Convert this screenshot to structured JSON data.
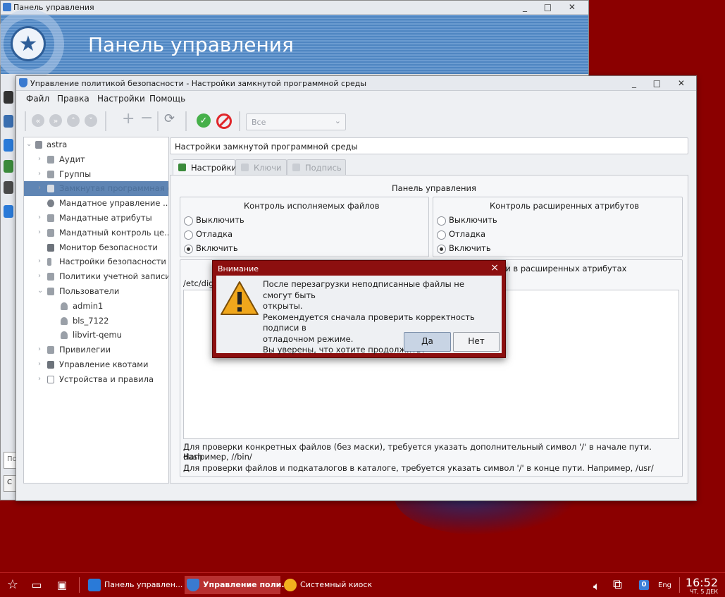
{
  "colors": {
    "desktop": "#8b0000",
    "accent": "#5f85b4",
    "dialog_frame": "#8c0f0f",
    "ok_green": "#46b04a",
    "cancel_red": "#e0262a"
  },
  "back_window": {
    "title": "Панель управления",
    "banner_title": "Панель управления",
    "search_placeholder": "По",
    "button_label": "С"
  },
  "main_window": {
    "title": "Управление политикой безопасности - Настройки замкнутой программной среды",
    "menu": [
      "Файл",
      "Правка",
      "Настройки",
      "Помощь"
    ],
    "toolbar": {
      "icons": [
        "back-double-icon",
        "forward-double-icon",
        "up-icon",
        "down-icon",
        "add-icon",
        "remove-icon",
        "refresh-icon",
        "apply-icon",
        "cancel-icon"
      ],
      "filter_value": "Все"
    }
  },
  "tree": {
    "root": "astra",
    "items": [
      {
        "label": "Аудит",
        "level": 1,
        "expandable": true
      },
      {
        "label": "Группы",
        "level": 1,
        "expandable": true
      },
      {
        "label": "Замкнутая программная среда",
        "level": 1,
        "expandable": true,
        "selected": true
      },
      {
        "label": "Мандатное управление ...",
        "level": 1,
        "expandable": false
      },
      {
        "label": "Мандатные атрибуты",
        "level": 1,
        "expandable": true
      },
      {
        "label": "Мандатный контроль це...",
        "level": 1,
        "expandable": true
      },
      {
        "label": "Монитор безопасности",
        "level": 1,
        "expandable": false
      },
      {
        "label": "Настройки безопасности",
        "level": 1,
        "expandable": true
      },
      {
        "label": "Политики учетной записи",
        "level": 1,
        "expandable": true
      },
      {
        "label": "Пользователи",
        "level": 1,
        "expandable": true,
        "expanded": true
      },
      {
        "label": "admin1",
        "level": 2,
        "expandable": false
      },
      {
        "label": "bls_7122",
        "level": 2,
        "expandable": false
      },
      {
        "label": "libvirt-qemu",
        "level": 2,
        "expandable": false
      },
      {
        "label": "Привилегии",
        "level": 1,
        "expandable": true
      },
      {
        "label": "Управление квотами",
        "level": 1,
        "expandable": true
      },
      {
        "label": "Устройства и правила",
        "level": 1,
        "expandable": true
      }
    ]
  },
  "content": {
    "path": "Настройки замкнутой программной среды",
    "tabs": [
      {
        "label": "Настройки",
        "active": true
      },
      {
        "label": "Ключи",
        "active": false
      },
      {
        "label": "Подпись",
        "active": false
      }
    ],
    "panel_title": "Панель управления",
    "exec_group": {
      "title": "Контроль исполняемых файлов",
      "options": [
        "Выключить",
        "Отладка",
        "Включить"
      ],
      "selected": 2
    },
    "xattr_group": {
      "title": "Контроль расширенных атрибутов",
      "options": [
        "Выключить",
        "Отладка",
        "Включить"
      ],
      "selected": 2
    },
    "xattr_list_title_fragment": "дписи в расширенных атрибутах",
    "list_first_item": "/etc/digs",
    "help_line1": "Для проверки конкретных файлов (без маски), требуется указать дополнительный символ '/' в начале пути. Например, //bin/",
    "help_line1b": "dash",
    "help_line2": "Для проверки файлов и подкаталогов в каталоге, требуется указать символ '/' в конце пути. Например, /usr/"
  },
  "dialog": {
    "title": "Внимание",
    "lines": [
      "После перезагрузки неподписанные файлы не смогут быть",
      "открыты.",
      "Рекомендуется сначала проверить корректность подписи в",
      "отладочном режиме.",
      "Вы уверены, что хотите продолжить?"
    ],
    "yes_label": "Да",
    "no_label": "Нет"
  },
  "taskbar": {
    "tasks": [
      {
        "label": "Панель управлен...",
        "active": false
      },
      {
        "label": "Управление поли...",
        "active": true
      },
      {
        "label": "Системный киоск",
        "active": false
      }
    ],
    "badge_count": "0",
    "lang": "Eng",
    "time": "16:52",
    "date": "ЧТ, 5 ДЕК"
  }
}
